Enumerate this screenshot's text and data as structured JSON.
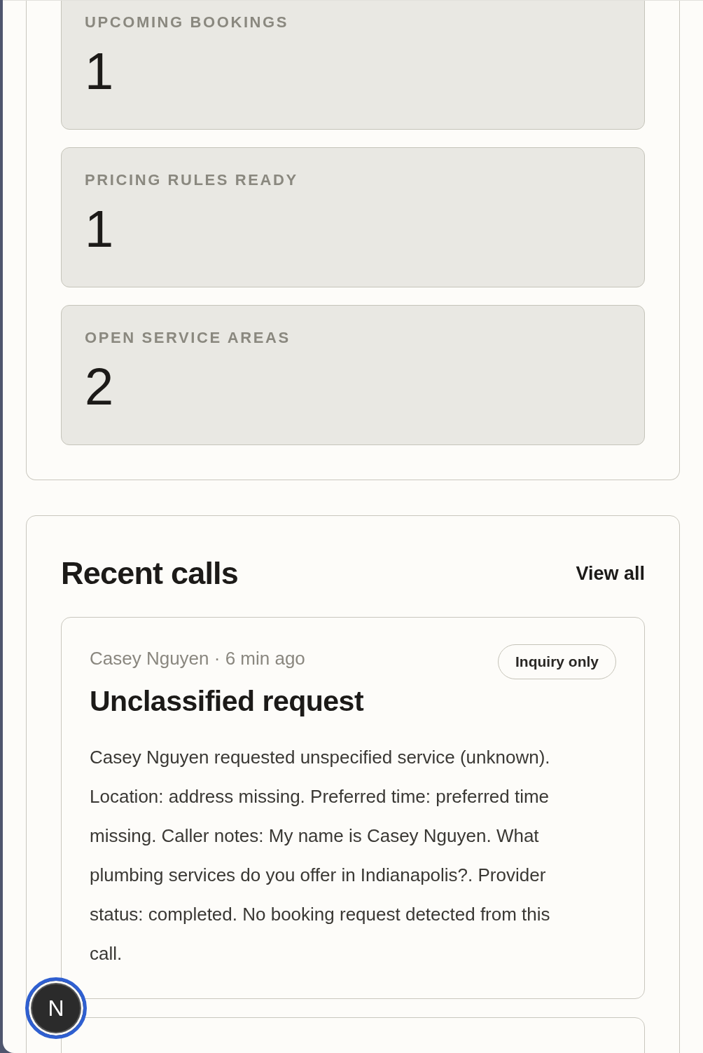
{
  "stats": [
    {
      "label": "UPCOMING BOOKINGS",
      "value": "1"
    },
    {
      "label": "PRICING RULES READY",
      "value": "1"
    },
    {
      "label": "OPEN SERVICE AREAS",
      "value": "2"
    }
  ],
  "recent_calls": {
    "title": "Recent calls",
    "view_all": "View all",
    "calls": [
      {
        "meta": "Casey Nguyen · 6 min ago",
        "badge": "Inquiry only",
        "title": "Unclassified request",
        "summary": "Casey Nguyen requested unspecified service (unknown). Location: address missing. Preferred time: preferred time missing. Caller notes: My name is Casey Nguyen. What plumbing services do you offer in Indianapolis?. Provider status: completed. No booking request detected from this call."
      }
    ]
  },
  "dev_button": {
    "label": "N"
  }
}
